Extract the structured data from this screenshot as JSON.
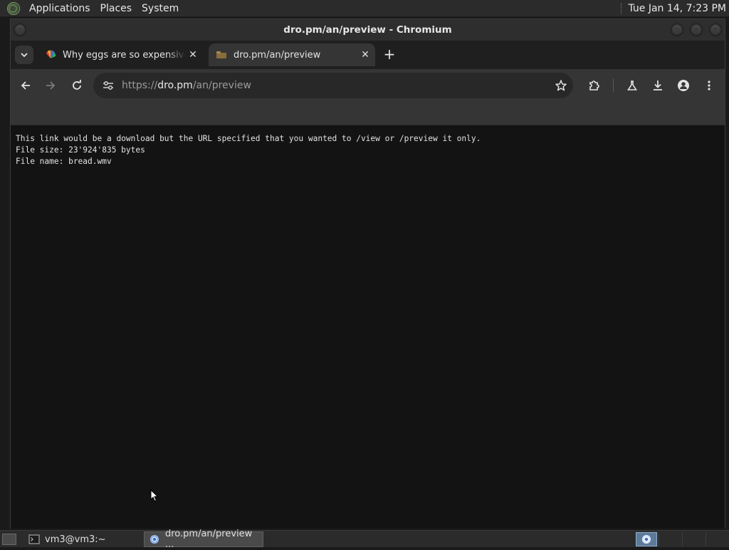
{
  "top_panel": {
    "menus": [
      "Applications",
      "Places",
      "System"
    ],
    "clock": "Tue Jan 14,  7:23 PM"
  },
  "window": {
    "title": "dro.pm/an/preview - Chromium"
  },
  "tabs": [
    {
      "title": "Why eggs are so expensive right now",
      "active": false,
      "favicon": "nbc-peacock-icon"
    },
    {
      "title": "dro.pm/an/preview",
      "active": true,
      "favicon": "dropm-icon"
    }
  ],
  "toolbar": {
    "url_scheme": "https://",
    "url_host": "dro.pm",
    "url_path": "/an/preview"
  },
  "page": {
    "line1": "This link would be a download but the URL specified that you wanted to /view or /preview it only.",
    "line2": "File size: 23'924'835 bytes",
    "line3": "File name: bread.wmv"
  },
  "taskbar": {
    "tasks": [
      {
        "label": "vm3@vm3:~",
        "icon": "terminal-icon"
      },
      {
        "label": "dro.pm/an/preview ...",
        "icon": "chromium-icon"
      }
    ]
  },
  "colors": {
    "panel_bg": "#2b2b2b",
    "window_bg": "#131313",
    "toolbar_bg": "#353535",
    "text": "#e2e2e2"
  }
}
